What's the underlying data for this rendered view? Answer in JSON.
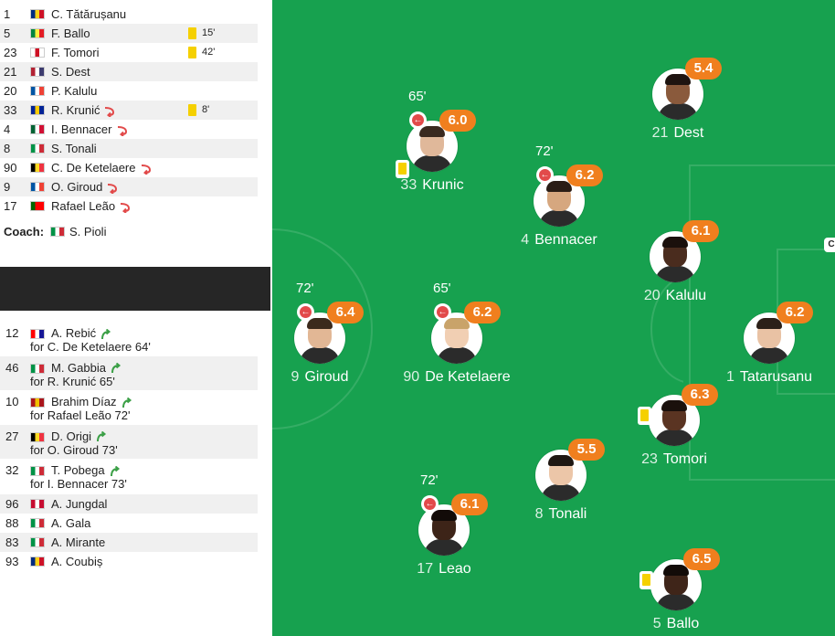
{
  "starters": [
    {
      "num": "1",
      "name": "C. Tătărușanu",
      "flag": [
        "#002b7f",
        "#fcd116",
        "#ce1126"
      ]
    },
    {
      "num": "5",
      "name": "F. Ballo",
      "flag": [
        "#00853f",
        "#fdef42",
        "#e31b23"
      ],
      "card": "15'"
    },
    {
      "num": "23",
      "name": "F. Tomori",
      "flag": [
        "#ffffff",
        "#ce1124",
        "#ffffff"
      ],
      "card": "42'"
    },
    {
      "num": "21",
      "name": "S. Dest",
      "flag": [
        "#b22234",
        "#ffffff",
        "#3c3b6e"
      ]
    },
    {
      "num": "20",
      "name": "P. Kalulu",
      "flag": [
        "#0055a4",
        "#ffffff",
        "#ef4135"
      ]
    },
    {
      "num": "33",
      "name": "R. Krunić",
      "flag": [
        "#002395",
        "#fecb00",
        "#002395"
      ],
      "subout": true,
      "card": "8'"
    },
    {
      "num": "4",
      "name": "I. Bennacer",
      "flag": [
        "#006233",
        "#ffffff",
        "#d21034"
      ],
      "subout": true
    },
    {
      "num": "8",
      "name": "S. Tonali",
      "flag": [
        "#009246",
        "#ffffff",
        "#ce2b37"
      ]
    },
    {
      "num": "90",
      "name": "C. De Ketelaere",
      "flag": [
        "#000000",
        "#fdda24",
        "#ef3340"
      ],
      "subout": true
    },
    {
      "num": "9",
      "name": "O. Giroud",
      "flag": [
        "#0055a4",
        "#ffffff",
        "#ef4135"
      ],
      "subout": true
    },
    {
      "num": "17",
      "name": "Rafael Leão",
      "flag": [
        "#006600",
        "#ff0000",
        "#ff0000"
      ],
      "subout": true
    }
  ],
  "coach": {
    "label": "Coach:",
    "name": "S. Pioli",
    "flag": [
      "#009246",
      "#ffffff",
      "#ce2b37"
    ]
  },
  "substitutes": [
    {
      "num": "12",
      "name": "A. Rebić",
      "for": "for C. De Ketelaere 64'",
      "flag": [
        "#ff0000",
        "#ffffff",
        "#171796"
      ]
    },
    {
      "num": "46",
      "name": "M. Gabbia",
      "for": "for R. Krunić 65'",
      "flag": [
        "#009246",
        "#ffffff",
        "#ce2b37"
      ]
    },
    {
      "num": "10",
      "name": "Brahim Díaz",
      "for": "for Rafael Leão 72'",
      "flag": [
        "#aa151b",
        "#f1bf00",
        "#aa151b"
      ]
    },
    {
      "num": "27",
      "name": "D. Origi",
      "for": "for O. Giroud 73'",
      "flag": [
        "#000000",
        "#fdda24",
        "#ef3340"
      ]
    },
    {
      "num": "32",
      "name": "T. Pobega",
      "for": "for I. Bennacer 73'",
      "flag": [
        "#009246",
        "#ffffff",
        "#ce2b37"
      ]
    }
  ],
  "reserves": [
    {
      "num": "96",
      "name": "A. Jungdal",
      "flag": [
        "#c60c30",
        "#ffffff",
        "#c60c30"
      ]
    },
    {
      "num": "88",
      "name": "A. Gala",
      "flag": [
        "#009246",
        "#ffffff",
        "#ce2b37"
      ]
    },
    {
      "num": "83",
      "name": "A. Mirante",
      "flag": [
        "#009246",
        "#ffffff",
        "#ce2b37"
      ]
    },
    {
      "num": "93",
      "name": "A. Coubiș",
      "flag": [
        "#002b7f",
        "#fcd116",
        "#ce1126"
      ]
    }
  ],
  "pitch": {
    "captain_label": "C",
    "players": [
      {
        "id": "dest",
        "num": "21",
        "name": "Dest",
        "rating": "5.4",
        "skin": "#8a5a3c",
        "hair": "#1e1410"
      },
      {
        "id": "krunic",
        "num": "33",
        "name": "Krunic",
        "rating": "6.0",
        "subout": "65'",
        "yellow": true,
        "skin": "#e0b89a",
        "hair": "#3a2a20"
      },
      {
        "id": "bennacer",
        "num": "4",
        "name": "Bennacer",
        "rating": "6.2",
        "subout": "72'",
        "skin": "#d6a77f",
        "hair": "#2a1d16"
      },
      {
        "id": "kalulu",
        "num": "20",
        "name": "Kalulu",
        "rating": "6.1",
        "skin": "#4a2c1e",
        "hair": "#1a100c"
      },
      {
        "id": "giroud",
        "num": "9",
        "name": "Giroud",
        "rating": "6.4",
        "subout": "72'",
        "skin": "#e2b795",
        "hair": "#3b2a1c"
      },
      {
        "id": "deketelaere",
        "num": "90",
        "name": "De Ketelaere",
        "rating": "6.2",
        "subout": "65'",
        "skin": "#f1cfb3",
        "hair": "#c9a36a"
      },
      {
        "id": "tatarusanu",
        "num": "1",
        "name": "Tatarusanu",
        "rating": "6.2",
        "skin": "#e9c2a4",
        "hair": "#2c2018"
      },
      {
        "id": "tomori",
        "num": "23",
        "name": "Tomori",
        "rating": "6.3",
        "yellow": true,
        "skin": "#5a3422",
        "hair": "#1a100c"
      },
      {
        "id": "tonali",
        "num": "8",
        "name": "Tonali",
        "rating": "5.5",
        "skin": "#ecc6a8",
        "hair": "#1f1712"
      },
      {
        "id": "leao",
        "num": "17",
        "name": "Leao",
        "rating": "6.1",
        "subout": "72'",
        "skin": "#3d2418",
        "hair": "#120b08"
      },
      {
        "id": "ballo",
        "num": "5",
        "name": "Ballo",
        "rating": "6.5",
        "yellow": true,
        "skin": "#3f2519",
        "hair": "#120b08"
      }
    ]
  },
  "colors": {
    "pitch": "#17a14f",
    "rating": "#f07f1e",
    "sub_out": "#e24a4a",
    "sub_in": "#3ca047",
    "yellow_card": "#f5d000"
  }
}
